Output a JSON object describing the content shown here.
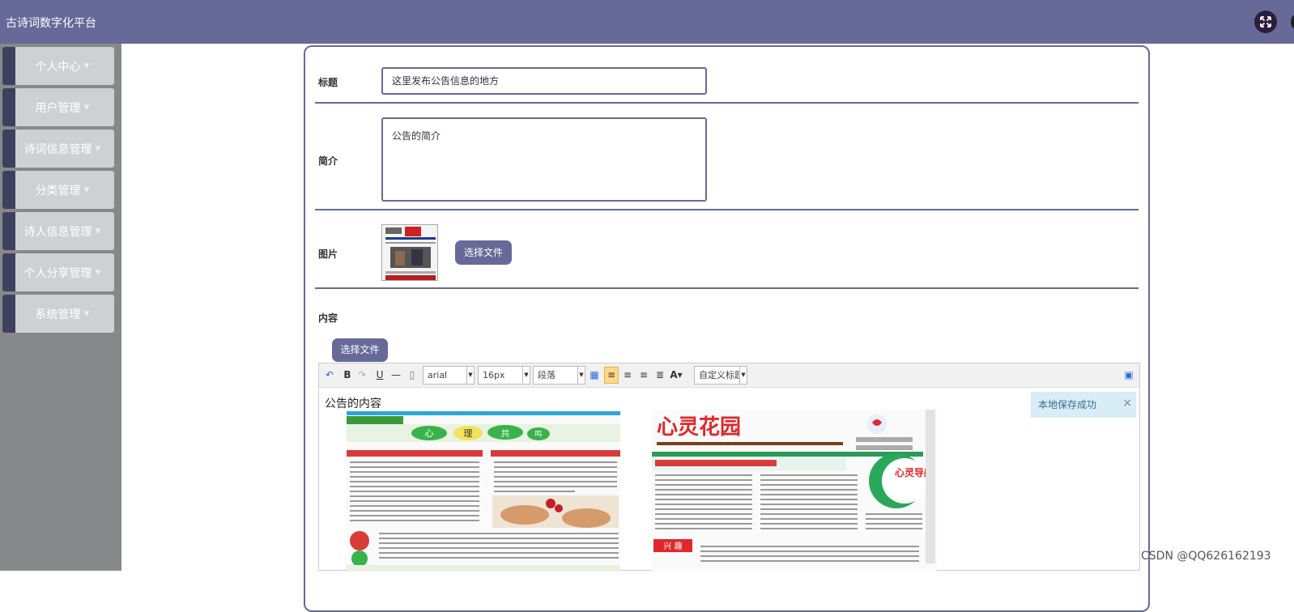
{
  "app": {
    "title": "古诗词数字化平台",
    "fullscreen_icon": "expand-arrows-icon"
  },
  "sidebar": {
    "items": [
      {
        "label": "个人中心"
      },
      {
        "label": "用户管理"
      },
      {
        "label": "诗词信息管理"
      },
      {
        "label": "分类管理"
      },
      {
        "label": "诗人信息管理"
      },
      {
        "label": "个人分享管理"
      },
      {
        "label": "系统管理"
      }
    ]
  },
  "form": {
    "title_label": "标题",
    "title_value": "这里发布公告信息的地方",
    "intro_label": "简介",
    "intro_value": "公告的简介",
    "image_label": "图片",
    "image_button": "选择文件",
    "content_label": "内容",
    "content_button": "选择文件"
  },
  "editor": {
    "font_family": "arial",
    "font_size": "16px",
    "paragraph": "段落",
    "custom_title": "自定义标题",
    "content_text": "公告的内容",
    "newspaper_left_title": "心 理 共 鸣",
    "newspaper_right_title": "心灵花园",
    "newspaper_right_badge": "心灵导航",
    "newspaper_right_section": "兴 趣"
  },
  "notice": {
    "text": "本地保存成功",
    "close": "×"
  },
  "watermark": "CSDN @QQ626162193",
  "colors": {
    "primary": "#676a98",
    "sidebar": "#87888a",
    "menu_item": "#cfd0d2"
  }
}
